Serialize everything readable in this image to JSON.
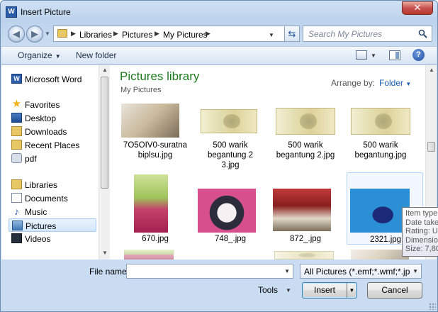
{
  "window": {
    "title": "Insert Picture",
    "app_icon_letter": "W",
    "close_glyph": "✕"
  },
  "address_bar": {
    "crumbs": [
      "Libraries",
      "Pictures",
      "My Pictures"
    ],
    "search_placeholder": "Search My Pictures"
  },
  "toolbar": {
    "organize_label": "Organize",
    "new_folder_label": "New folder",
    "help_glyph": "?"
  },
  "nav_pane": {
    "items": [
      {
        "label": "Microsoft Word",
        "icon": "word-icon",
        "level": 0
      },
      {
        "label": "Favorites",
        "icon": "star-icon",
        "level": 0
      },
      {
        "label": "Desktop",
        "icon": "desktop-icon",
        "level": 1
      },
      {
        "label": "Downloads",
        "icon": "downloads-icon",
        "level": 1
      },
      {
        "label": "Recent Places",
        "icon": "recent-places-icon",
        "level": 1
      },
      {
        "label": "pdf",
        "icon": "pdf-folder-icon",
        "level": 1
      },
      {
        "label": "Libraries",
        "icon": "libraries-icon",
        "level": 0
      },
      {
        "label": "Documents",
        "icon": "documents-icon",
        "level": 1
      },
      {
        "label": "Music",
        "icon": "music-icon",
        "level": 1
      },
      {
        "label": "Pictures",
        "icon": "pictures-icon",
        "level": 1,
        "selected": true
      },
      {
        "label": "Videos",
        "icon": "videos-icon",
        "level": 1
      }
    ]
  },
  "content": {
    "library_title": "Pictures library",
    "library_subtitle": "My Pictures",
    "arrange_by_label": "Arrange by:",
    "arrange_by_value": "Folder",
    "files": [
      {
        "name_line1": "7O5OIV0-suratna",
        "name_line2": "biplsu.jpg",
        "name_line3": ""
      },
      {
        "name_line1": "500 warik",
        "name_line2": "begantung 2",
        "name_line3": "3.jpg"
      },
      {
        "name_line1": "500 warik",
        "name_line2": "begantung 2.jpg",
        "name_line3": ""
      },
      {
        "name_line1": "500 warik",
        "name_line2": "begantung.jpg",
        "name_line3": ""
      },
      {
        "name_line1": "670.jpg",
        "name_line2": "",
        "name_line3": ""
      },
      {
        "name_line1": "748_.jpg",
        "name_line2": "",
        "name_line3": ""
      },
      {
        "name_line1": "872_.jpg",
        "name_line2": "",
        "name_line3": ""
      },
      {
        "name_line1": "2321.jpg",
        "name_line2": "",
        "name_line3": ""
      }
    ],
    "tooltip_lines": [
      "Item type",
      "Date take",
      "Rating: Un",
      "Dimensio",
      "Size: 7,80"
    ]
  },
  "footer": {
    "file_name_label": "File name:",
    "file_name_value": "",
    "filter_value": "All Pictures (*.emf;*.wmf;*.jpg;*",
    "tools_label": "Tools",
    "insert_label": "Insert",
    "cancel_label": "Cancel"
  },
  "colors": {
    "library_title": "#1e7a1e",
    "link_blue": "#1a5fb4",
    "close_red": "#c75050"
  }
}
